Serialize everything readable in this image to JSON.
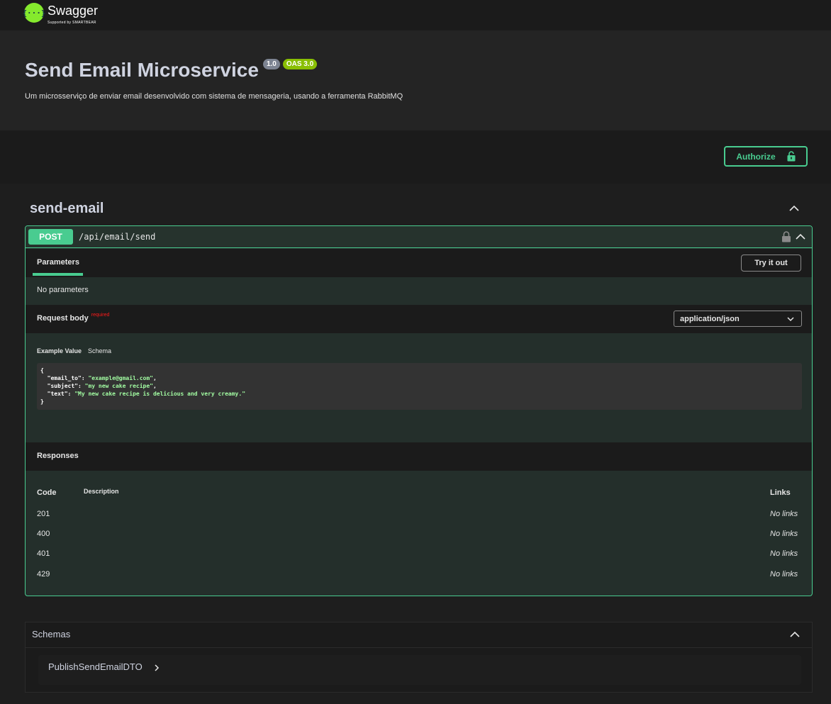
{
  "header": {
    "logo_name": "Swagger",
    "logo_sub": "Supported by SMARTBEAR",
    "logo_glyph": "{···}"
  },
  "info": {
    "title": "Send Email Microservice",
    "version": "1.0",
    "oas": "OAS 3.0",
    "description": "Um microsserviço de enviar email desenvolvido com sistema de mensageria, usando a ferramenta RabbitMQ"
  },
  "auth": {
    "label": "Authorize",
    "icon": "unlock-icon"
  },
  "tag": {
    "name": "send-email"
  },
  "operation": {
    "method": "POST",
    "path": "/api/email/send",
    "parameters_tab": "Parameters",
    "try_it_out": "Try it out",
    "no_parameters": "No parameters",
    "request_body_label": "Request body",
    "required_label": "required",
    "content_type": "application/json",
    "example_value_tab": "Example Value",
    "schema_tab": "Schema",
    "example": {
      "email_to_key": "\"email_to\"",
      "email_to_value": "\"example@gmail.com\"",
      "subject_key": "\"subject\"",
      "subject_value": "\"my new cake recipe\"",
      "text_key": "\"text\"",
      "text_value": "\"My new cake recipe is delicious and very creamy.\""
    },
    "responses_label": "Responses",
    "responses_columns": {
      "code": "Code",
      "description": "Description",
      "links": "Links"
    },
    "responses": [
      {
        "code": "201",
        "links": "No links"
      },
      {
        "code": "400",
        "links": "No links"
      },
      {
        "code": "401",
        "links": "No links"
      },
      {
        "code": "429",
        "links": "No links"
      }
    ]
  },
  "schemas": {
    "title": "Schemas",
    "models": [
      {
        "name": "PublishSendEmailDTO"
      }
    ]
  },
  "colors": {
    "post_green": "#49cc90",
    "oas_badge": "#89bf04",
    "version_badge": "#7d8492",
    "required_red": "#ff1a1a",
    "logo_green": "#85ea2d"
  }
}
